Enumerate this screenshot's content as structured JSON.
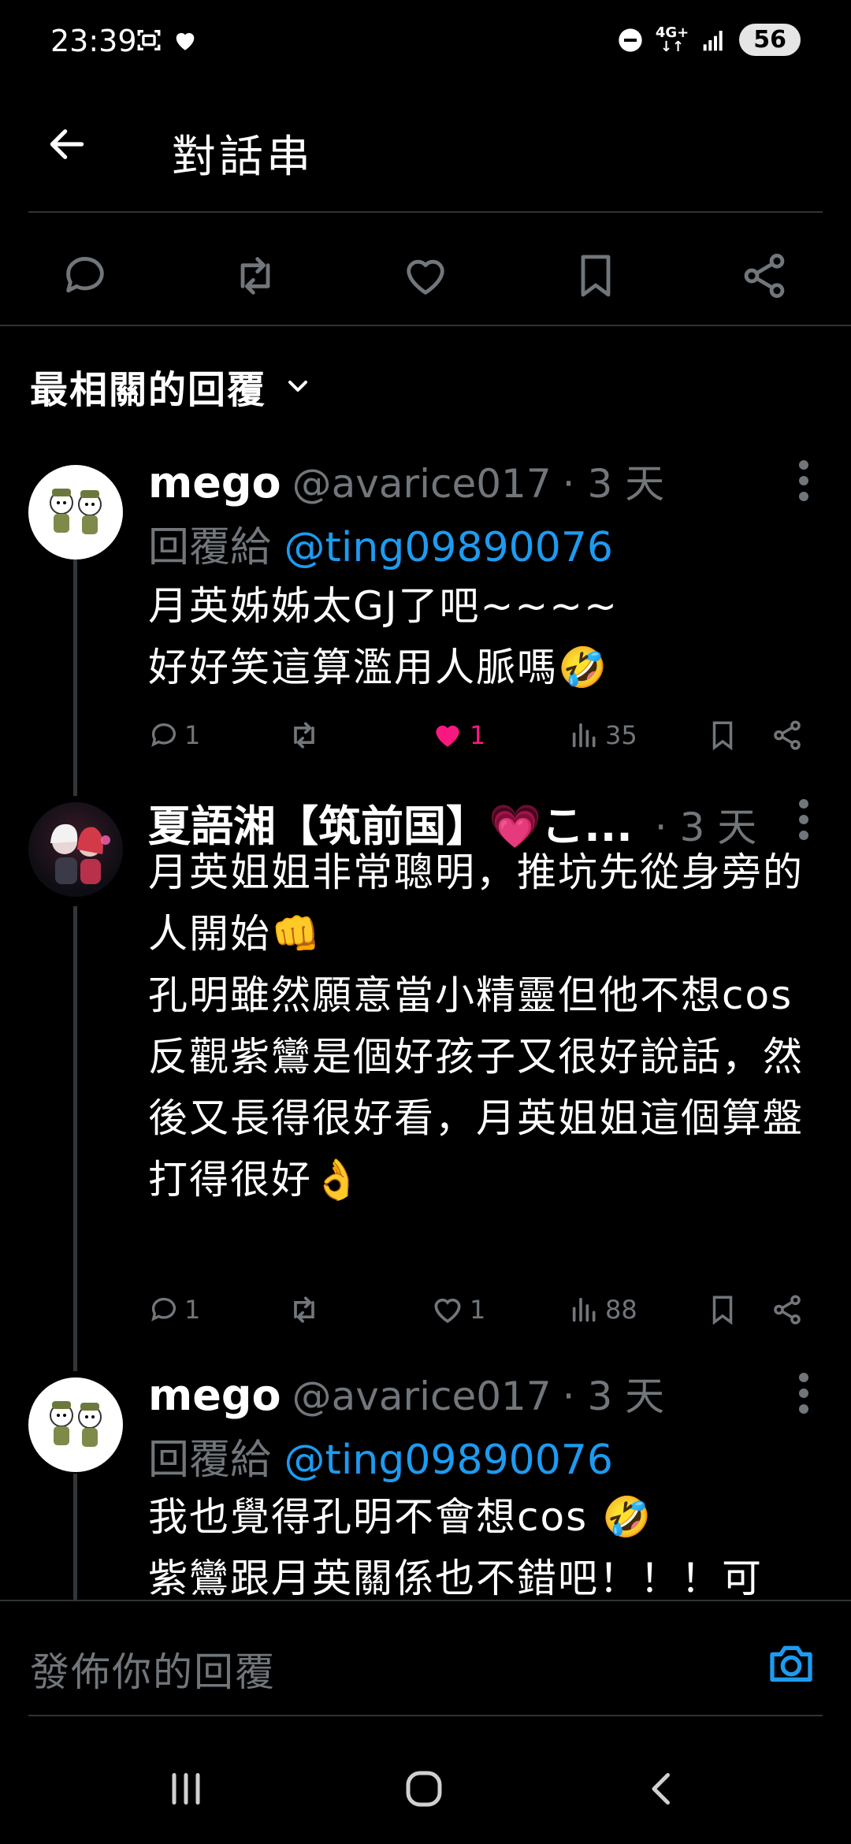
{
  "status_bar": {
    "time": "23:39",
    "network": "4G+",
    "battery": "56"
  },
  "header": {
    "title": "對話串"
  },
  "sort": {
    "label": "最相關的回覆"
  },
  "tweets": [
    {
      "name": "mego",
      "handle": "@avarice017",
      "time": "· 3 天",
      "reply_prefix": "回覆給",
      "reply_mention": "@ting09890076",
      "text": "月英姊姊太GJ了吧~~~~\n好好笑這算濫用人脈嗎🤣",
      "replies": "1",
      "likes": "1",
      "views": "35",
      "liked": true
    },
    {
      "name": "夏語湘【筑前国】💗こ...",
      "handle": "",
      "time": "· 3 天",
      "text": "月英姐姐非常聰明，推坑先從身旁的人開始👊\n孔明雖然願意當小精靈但他不想cos\n反觀紫鸞是個好孩子又很好說話，然後又長得很好看，月英姐姐這個算盤打得很好👌",
      "replies": "1",
      "likes": "1",
      "views": "88",
      "liked": false
    },
    {
      "name": "mego",
      "handle": "@avarice017",
      "time": "· 3 天",
      "reply_prefix": "回覆給",
      "reply_mention": "@ting09890076",
      "text": "我也覺得孔明不會想cos 🤣\n紫鸞跟月英關係也不錯吧！！！可"
    }
  ],
  "reply_bar": {
    "placeholder": "發佈你的回覆"
  },
  "colors": {
    "accent": "#1d9bf0",
    "like": "#f91880",
    "muted": "#71767b",
    "background": "#000000"
  }
}
